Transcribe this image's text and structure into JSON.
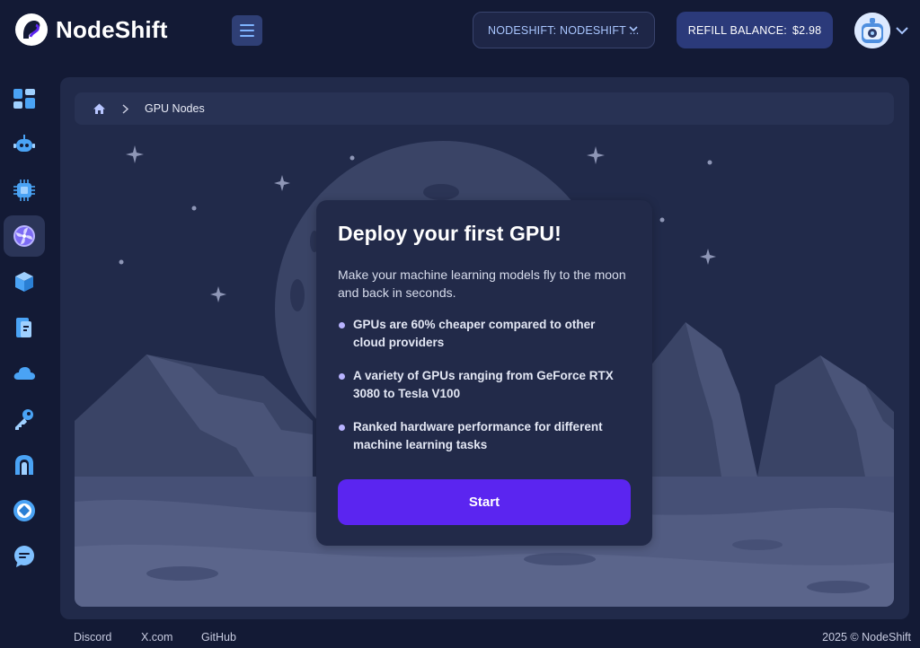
{
  "header": {
    "brand": "NodeShift",
    "org_selector": "NODESHIFT: NODESHIFT ...",
    "refill_label": "REFILL BALANCE:",
    "balance": "$2.98"
  },
  "sidebar": {
    "items": [
      {
        "icon": "dashboard-icon",
        "active": false
      },
      {
        "icon": "robot-icon",
        "active": false
      },
      {
        "icon": "cpu-chip-icon",
        "active": false
      },
      {
        "icon": "gpu-fan-icon",
        "active": true
      },
      {
        "icon": "cube-icon",
        "active": false
      },
      {
        "icon": "storage-icon",
        "active": false
      },
      {
        "icon": "cloud-icon",
        "active": false
      },
      {
        "icon": "key-icon",
        "active": false
      },
      {
        "icon": "network-icon",
        "active": false
      },
      {
        "icon": "target-icon",
        "active": false
      },
      {
        "icon": "chat-support-icon",
        "active": false
      }
    ]
  },
  "breadcrumb": {
    "home_icon": "home-icon",
    "separator_icon": "chevron-right-icon",
    "current": "GPU Nodes"
  },
  "card": {
    "title": "Deploy your first GPU!",
    "description": "Make your machine learning models fly to the moon and back in seconds.",
    "bullets": [
      "GPUs are 60% cheaper compared to other cloud providers",
      "A variety of GPUs ranging from GeForce RTX 3080 to Tesla V100",
      "Ranked hardware performance for different machine learning tasks"
    ],
    "button": "Start"
  },
  "footer": {
    "links": [
      "Discord",
      "X.com",
      "GitHub"
    ],
    "copyright": "2025 © NodeShift"
  },
  "colors": {
    "background": "#131a35",
    "panel": "#212a4a",
    "accent_purple": "#5b25f0",
    "accent_blue": "#3b9bf5"
  }
}
